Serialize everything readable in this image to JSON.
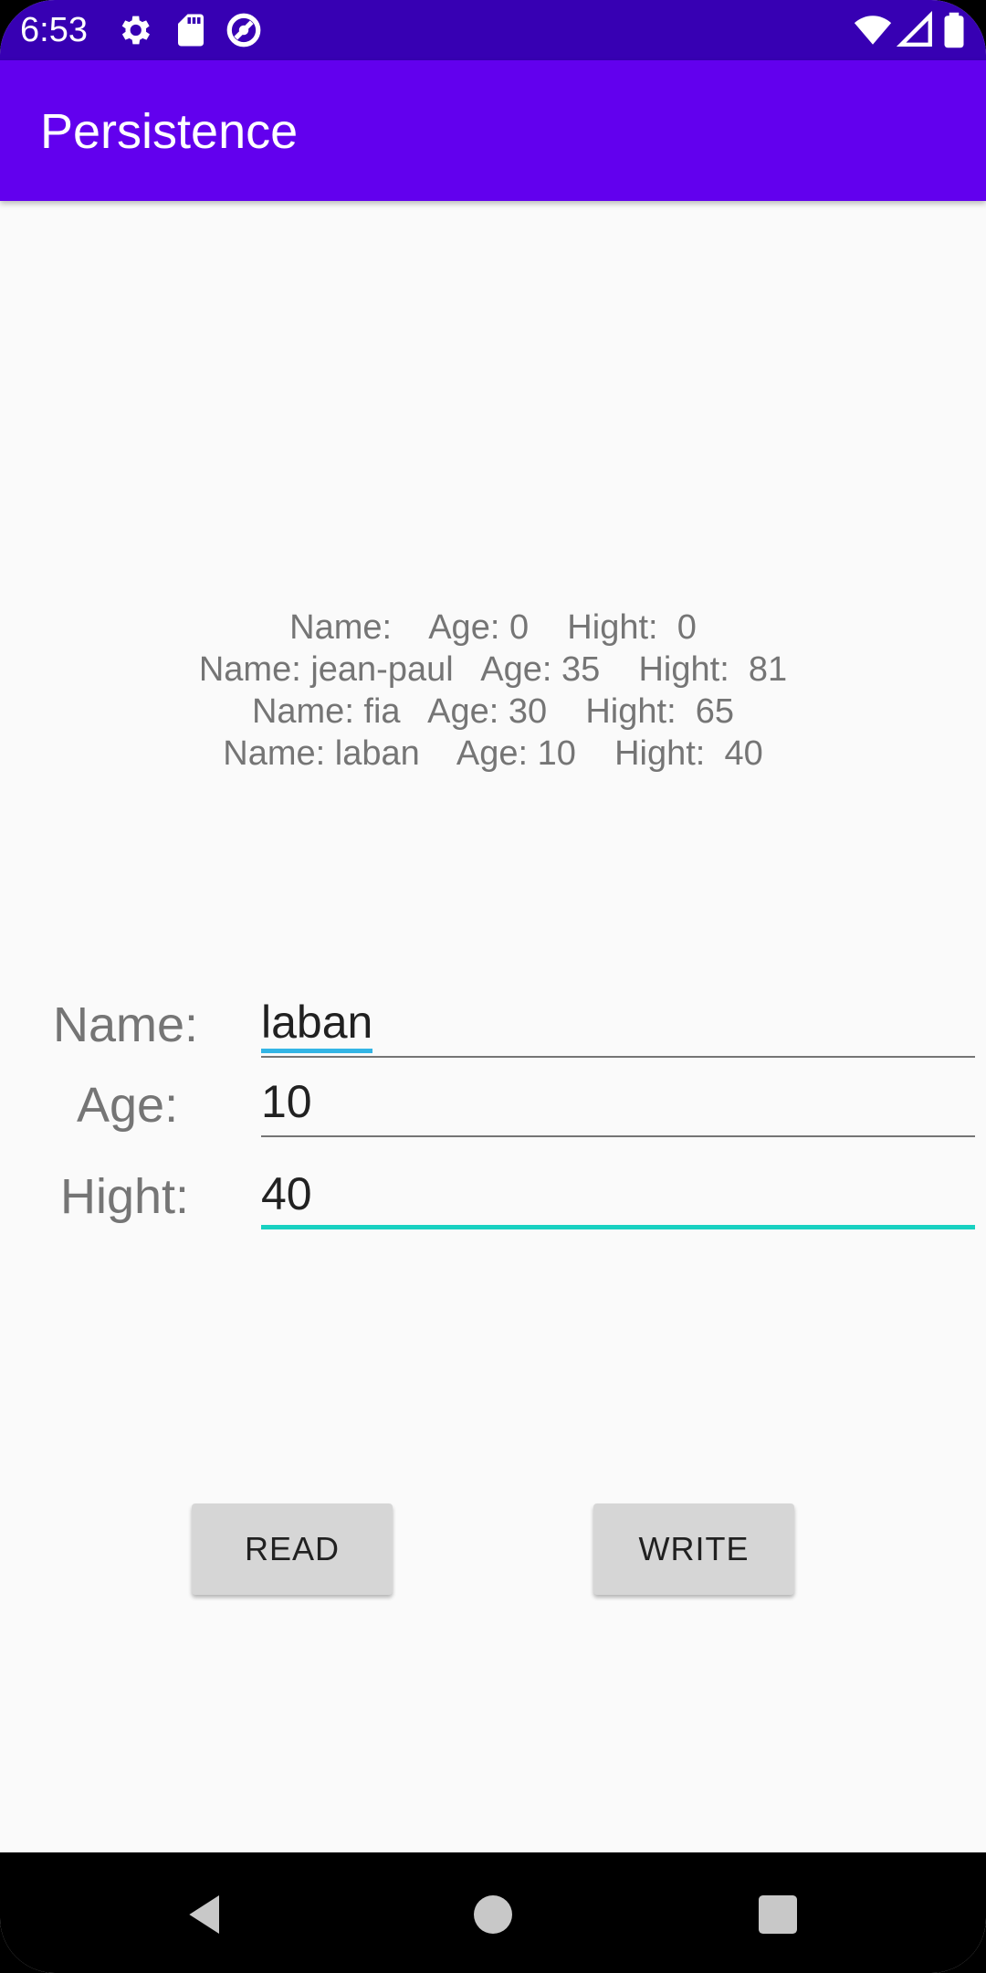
{
  "status_bar": {
    "time": "6:53",
    "icons": [
      "settings-icon",
      "sd-card-icon",
      "vpn-icon",
      "wifi-icon",
      "signal-icon",
      "battery-icon"
    ]
  },
  "app_bar": {
    "title": "Persistence"
  },
  "records": [
    "Name:    Age: 0    Hight:  0",
    "Name: jean-paul   Age: 35    Hight:  81",
    "Name: fia   Age: 30    Hight:  65",
    "Name: laban    Age: 10    Hight:  40"
  ],
  "form": {
    "name_label": "Name:",
    "name_value": "laban",
    "age_label": "Age:",
    "age_value": "10",
    "height_label": "Hight:",
    "height_value": "40"
  },
  "buttons": {
    "read": "READ",
    "write": "WRITE"
  },
  "colors": {
    "status_bar": "#3700b3",
    "app_bar": "#6200ee",
    "focus_accent": "#18d1c1",
    "background": "#fafafa"
  },
  "nav_bar": {
    "icons": [
      "back-icon",
      "home-icon",
      "recents-icon"
    ]
  }
}
